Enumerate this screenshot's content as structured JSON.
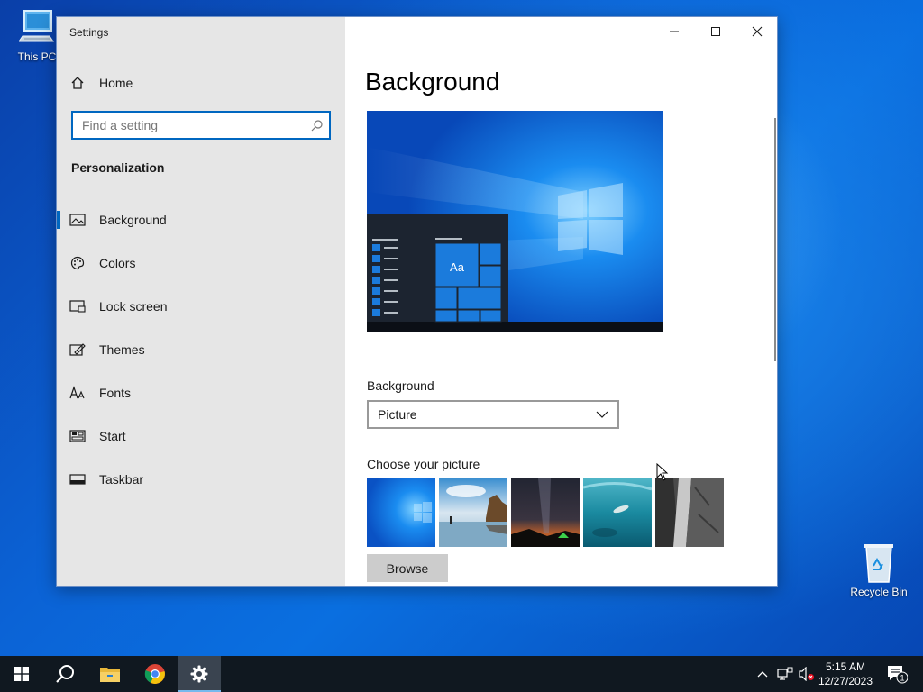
{
  "desktop": {
    "icons": [
      {
        "label": "This PC",
        "icon": "computer-icon"
      },
      {
        "label": "Recycle Bin",
        "icon": "recycle-bin-icon"
      }
    ]
  },
  "window": {
    "title": "Settings",
    "controls": [
      "minimize-icon",
      "maximize-icon",
      "close-icon"
    ]
  },
  "sidebar": {
    "home_label": "Home",
    "search": {
      "placeholder": "Find a setting",
      "value": ""
    },
    "section": "Personalization",
    "items": [
      {
        "label": "Background",
        "icon": "picture-icon",
        "active": true
      },
      {
        "label": "Colors",
        "icon": "palette-icon",
        "active": false
      },
      {
        "label": "Lock screen",
        "icon": "lock-screen-icon",
        "active": false
      },
      {
        "label": "Themes",
        "icon": "themes-icon",
        "active": false
      },
      {
        "label": "Fonts",
        "icon": "fonts-icon",
        "active": false
      },
      {
        "label": "Start",
        "icon": "start-icon",
        "active": false
      },
      {
        "label": "Taskbar",
        "icon": "taskbar-icon",
        "active": false
      }
    ]
  },
  "main": {
    "title": "Background",
    "preview_tile_text": "Aa",
    "background_label": "Background",
    "background_select": {
      "value": "Picture"
    },
    "choose_label": "Choose your picture",
    "browse_label": "Browse"
  },
  "taskbar": {
    "time": "5:15 AM",
    "date": "12/27/2023",
    "notification_count": "1",
    "accent_color": "#76b9ed"
  }
}
